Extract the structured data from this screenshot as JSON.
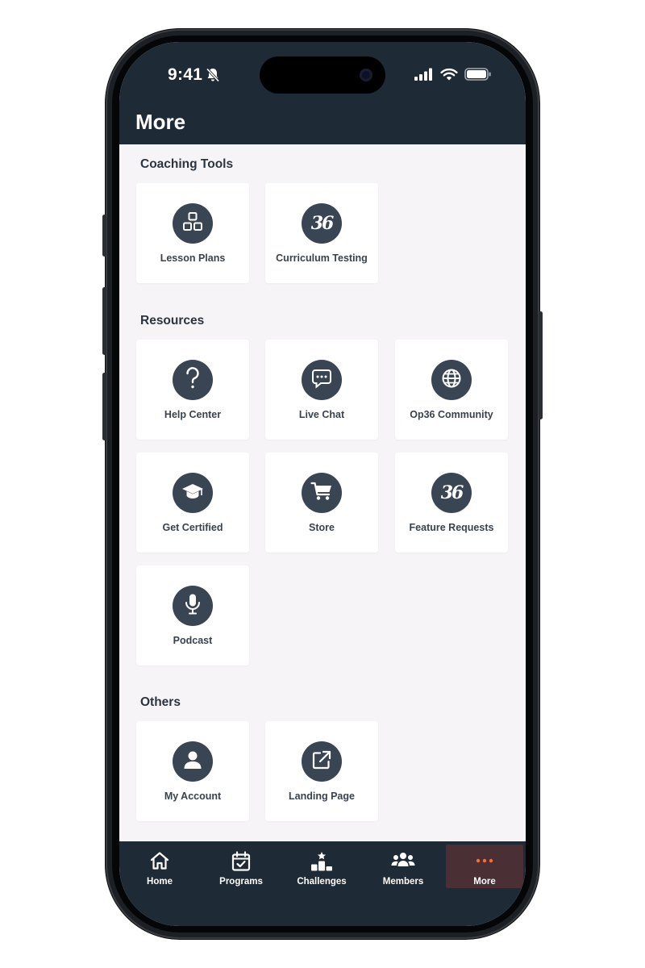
{
  "status": {
    "time": "9:41"
  },
  "header": {
    "title": "More"
  },
  "sections": [
    {
      "title": "Coaching Tools",
      "items": [
        {
          "label": "Lesson Plans",
          "icon": "lesson-plans-icon"
        },
        {
          "label": "Curriculum Testing",
          "icon": "op36-logo-icon"
        }
      ]
    },
    {
      "title": "Resources",
      "items": [
        {
          "label": "Help Center",
          "icon": "question-icon"
        },
        {
          "label": "Live Chat",
          "icon": "chat-bubble-icon"
        },
        {
          "label": "Op36 Community",
          "icon": "globe-icon"
        },
        {
          "label": "Get Certified",
          "icon": "graduation-cap-icon"
        },
        {
          "label": "Store",
          "icon": "shopping-cart-icon"
        },
        {
          "label": "Feature Requests",
          "icon": "op36-logo-icon"
        },
        {
          "label": "Podcast",
          "icon": "microphone-icon"
        }
      ]
    },
    {
      "title": "Others",
      "items": [
        {
          "label": "My Account",
          "icon": "user-icon"
        },
        {
          "label": "Landing Page",
          "icon": "external-link-icon"
        }
      ]
    }
  ],
  "brand_mark": "36",
  "tabs": [
    {
      "label": "Home",
      "icon": "home-icon"
    },
    {
      "label": "Programs",
      "icon": "calendar-check-icon"
    },
    {
      "label": "Challenges",
      "icon": "podium-icon"
    },
    {
      "label": "Members",
      "icon": "members-icon"
    },
    {
      "label": "More",
      "icon": "ellipsis-icon",
      "active": true
    }
  ],
  "colors": {
    "header_bg": "#1e2a36",
    "page_bg": "#f6f4f7",
    "icon_circle": "#3a4554",
    "accent": "#ff6b35",
    "active_tab_bg": "#4a2f35"
  }
}
